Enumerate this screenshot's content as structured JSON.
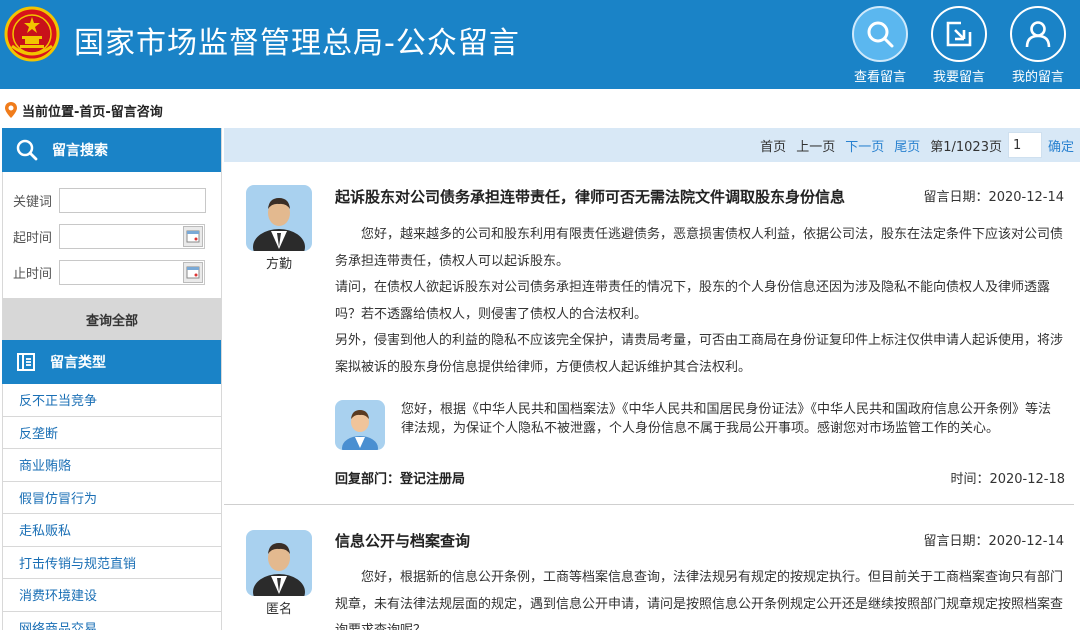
{
  "header": {
    "title": "国家市场监督管理总局-公众留言",
    "buttons": [
      {
        "label": "查看留言",
        "icon": "search-icon"
      },
      {
        "label": "我要留言",
        "icon": "edit-icon"
      },
      {
        "label": "我的留言",
        "icon": "user-icon"
      }
    ],
    "colors": {
      "bar": "#1a83c7",
      "active": "#5bb7ef"
    }
  },
  "breadcrumb": "当前位置-首页-留言咨询",
  "sidebar": {
    "search_title": "留言搜索",
    "keyword_label": "关键词",
    "start_label": "起时间",
    "end_label": "止时间",
    "query_all": "查询全部",
    "types_title": "留言类型",
    "types": [
      "反不正当竞争",
      "反垄断",
      "商业贿赂",
      "假冒仿冒行为",
      "走私贩私",
      "打击传销与规范直销",
      "消费环境建设",
      "网络商品交易"
    ]
  },
  "pager": {
    "first": "首页",
    "prev": "上一页",
    "next": "下一页",
    "last": "尾页",
    "info": "第1/1023页",
    "page_value": "1",
    "ok": "确定"
  },
  "messages": [
    {
      "author": "方勤",
      "title": "起诉股东对公司债务承担连带责任，律师可否无需法院文件调取股东身份信息",
      "date": "留言日期：2020-12-14",
      "paragraphs": [
        "　　您好，越来越多的公司和股东利用有限责任逃避债务，恶意损害债权人利益，依据公司法，股东在法定条件下应该对公司债务承担连带责任，债权人可以起诉股东。",
        "请问，在债权人欲起诉股东对公司债务承担连带责任的情况下，股东的个人身份信息还因为涉及隐私不能向债权人及律师透露吗？若不透露给债权人，则侵害了债权人的合法权利。",
        "另外，侵害到他人的利益的隐私不应该完全保护，请贵局考量，可否由工商局在身份证复印件上标注仅供申请人起诉使用，将涉案拟被诉的股东身份信息提供给律师，方便债权人起诉维护其合法权利。"
      ],
      "reply": "您好，根据《中华人民共和国档案法》《中华人民共和国居民身份证法》《中华人民共和国政府信息公开条例》等法律法规，为保证个人隐私不被泄露，个人身份信息不属于我局公开事项。感谢您对市场监管工作的关心。",
      "reply_dept": "回复部门：登记注册局",
      "reply_time": "时间：2020-12-18"
    },
    {
      "author": "匿名",
      "title": "信息公开与档案查询",
      "date": "留言日期：2020-12-14",
      "paragraphs": [
        "　　您好，根据新的信息公开条例，工商等档案信息查询，法律法规另有规定的按规定执行。但目前关于工商档案查询只有部门规章，未有法律法规层面的规定，遇到信息公开申请，请问是按照信息公开条例规定公开还是继续按照部门规章规定按照档案查询要求查询呢？"
      ]
    }
  ]
}
